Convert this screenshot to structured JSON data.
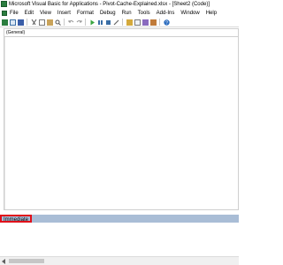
{
  "window": {
    "title": "Microsoft Visual Basic for Applications - Pivot-Cache-Explained.xlsx - [Sheet2 (Code)]"
  },
  "menubar": {
    "items": [
      "File",
      "Edit",
      "View",
      "Insert",
      "Format",
      "Debug",
      "Run",
      "Tools",
      "Add-Ins",
      "Window",
      "Help"
    ]
  },
  "toolbar": {
    "icons": [
      "excel-icon",
      "insert-userform-icon",
      "save-icon",
      "cut-icon",
      "copy-icon",
      "paste-icon",
      "find-icon",
      "undo-icon",
      "redo-icon",
      "run-icon",
      "break-icon",
      "reset-icon",
      "design-mode-icon",
      "project-explorer-icon",
      "properties-icon",
      "object-browser-icon",
      "toolbox-icon",
      "help-icon"
    ]
  },
  "code_pane": {
    "object_dropdown": "(General)"
  },
  "immediate": {
    "label": "Immediate"
  },
  "colors": {
    "immediate_header": "#a9bdd6",
    "highlight_border": "#e0101a"
  }
}
